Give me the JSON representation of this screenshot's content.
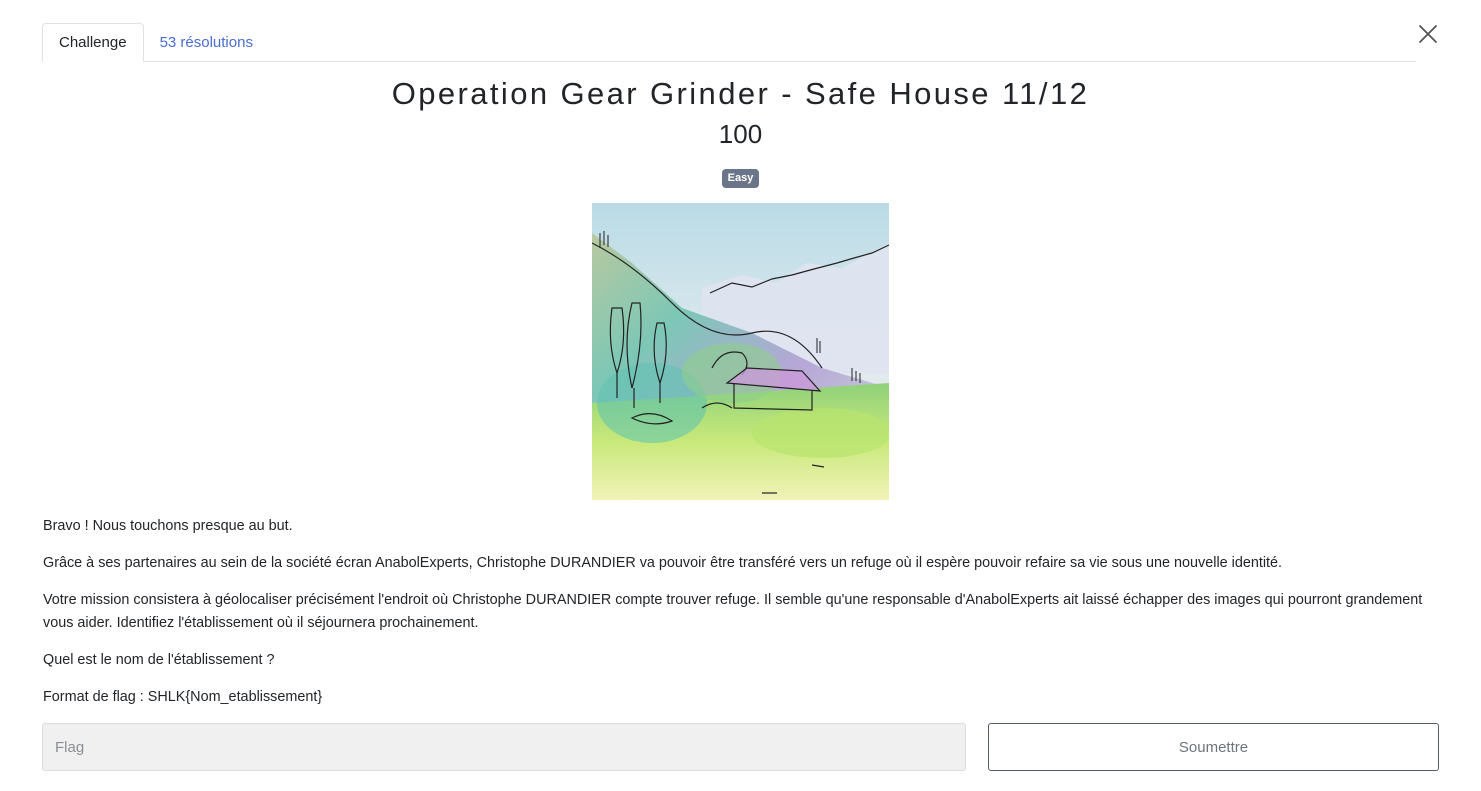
{
  "tabs": [
    {
      "label": "Challenge"
    },
    {
      "label": "53 résolutions"
    }
  ],
  "challenge": {
    "title": "Operation Gear Grinder - Safe House 11/12",
    "points": "100",
    "difficulty": "Easy"
  },
  "description": {
    "paragraphs": [
      "Bravo ! Nous touchons presque au but.",
      "Grâce à ses partenaires au sein de la société écran AnabolExperts, Christophe DURANDIER va pouvoir être transféré vers un refuge où il espère pouvoir refaire sa vie sous une nouvelle identité.",
      "Votre mission consistera à géolocaliser précisément l'endroit où Christophe DURANDIER compte trouver refuge. Il semble qu'une responsable d'AnabolExperts ait laissé échapper des images qui pourront grandement vous aider. Identifiez l'établissement où il séjournera prochainement.",
      "Quel est le nom de l'établissement ?",
      "Format de flag : SHLK{Nom_etablissement}"
    ]
  },
  "form": {
    "flag_placeholder": "Flag",
    "flag_value": "",
    "submit_label": "Soumettre"
  },
  "icons": {
    "close": "close-icon"
  },
  "colors": {
    "link": "#4a6ed0",
    "badge": "#6b7589",
    "input_bg": "#f0f0f0"
  }
}
